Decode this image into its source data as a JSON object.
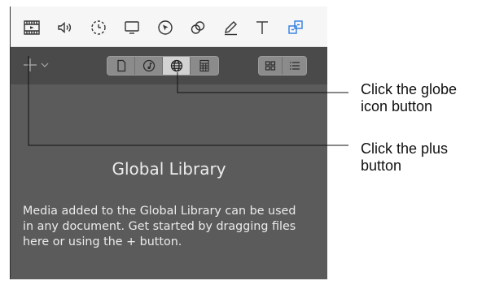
{
  "toolbar": {
    "icons": [
      "film-icon",
      "speaker-icon",
      "dashed-circle-icon",
      "monitor-icon",
      "cursor-circle-icon",
      "overlap-circles-icon",
      "pencil-icon",
      "text-t-icon",
      "group-shapes-icon"
    ],
    "accent_color": "#2f7de1"
  },
  "library_bar": {
    "source_tabs": [
      "document-icon",
      "music-icon",
      "globe-icon",
      "grid-icon"
    ],
    "active_tab": "globe-icon",
    "view_modes": [
      "grid-view-icon",
      "list-view-icon"
    ]
  },
  "library": {
    "title": "Global Library",
    "description": "Media added to the Global Library can be used\nin any document.  Get started by dragging files\nhere or using the + button."
  },
  "callouts": {
    "globe": "Click the globe\nicon button",
    "plus": "Click the plus\nbutton"
  }
}
